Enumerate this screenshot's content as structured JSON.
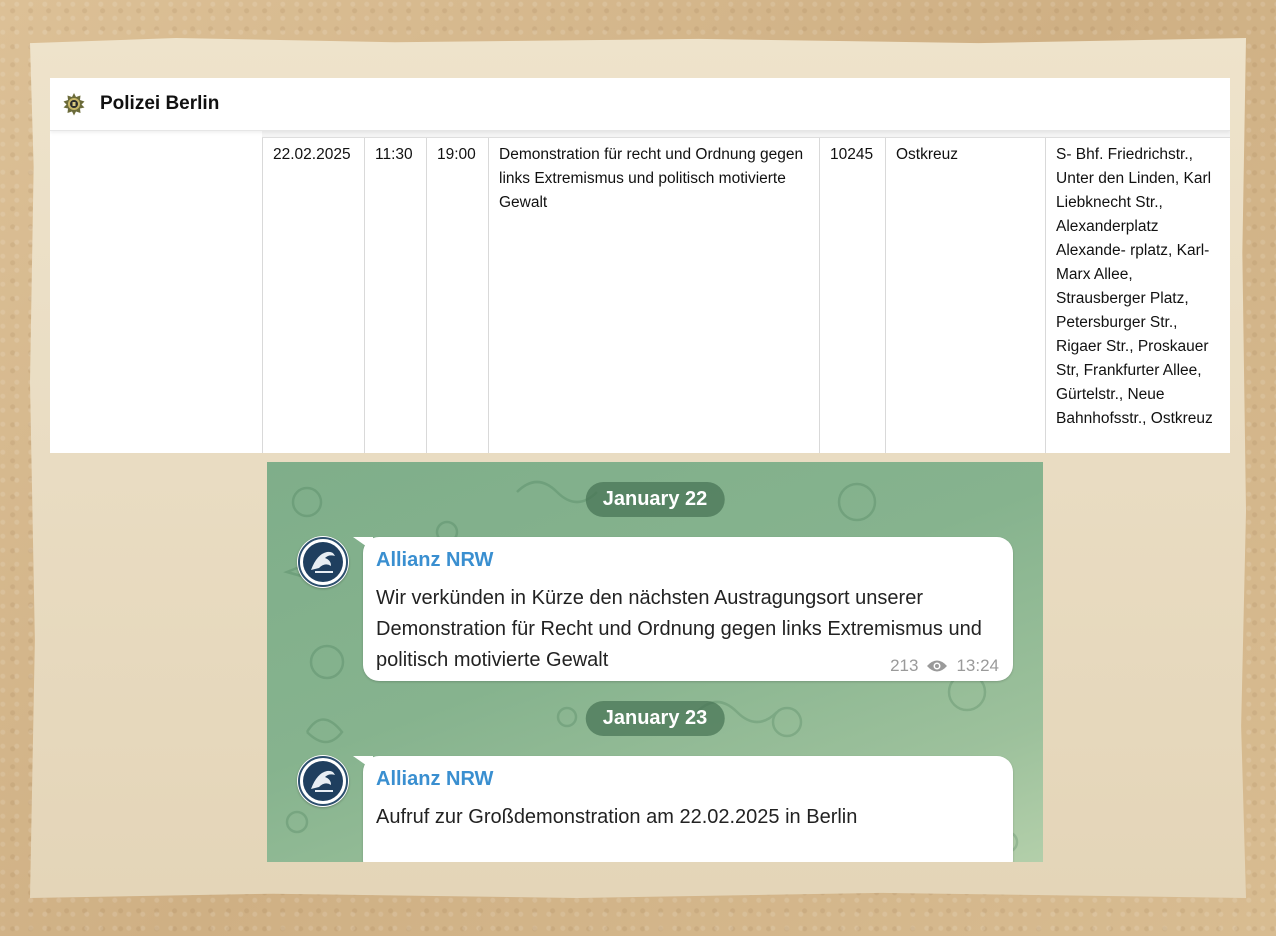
{
  "police": {
    "title": "Polizei Berlin",
    "logo_icon": "police-star-icon",
    "row": {
      "date": "22.02.2025",
      "start": "11:30",
      "end": "19:00",
      "topic": "Demonstration für recht und Ordnung gegen links Extremismus und politisch motivierte Gewalt",
      "postcode": "10245",
      "location": "Ostkreuz",
      "route": "S- Bhf. Friedrichstr., Unter den Linden, Karl Liebknecht Str., Alexanderplatz Alexande- rplatz, Karl-Marx Allee, Strausberger Platz, Petersburger Str., Rigaer Str., Proskauer Str, Frankfurter Allee, Gürtelstr., Neue Bahnhofsstr., Ostkreuz"
    }
  },
  "telegram": {
    "dates": [
      "January 22",
      "January 23"
    ],
    "messages": [
      {
        "sender": "Allianz NRW",
        "text": "Wir verkünden in Kürze den nächsten Austragungsort unserer Demonstration für Recht und Ordnung gegen links Extremismus und politisch motivierte Gewalt",
        "views": "213",
        "time": "13:24"
      },
      {
        "sender": "Allianz NRW",
        "text": "Aufruf zur Großdemonstration am 22.02.2025 in Berlin"
      }
    ],
    "colors": {
      "sender": "#3a8fd0",
      "background": "#86b38e"
    }
  }
}
